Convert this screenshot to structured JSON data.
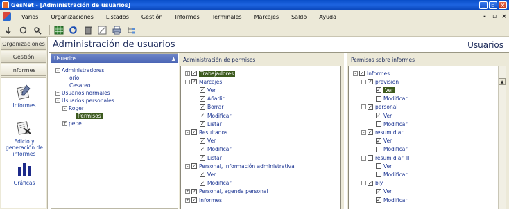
{
  "window": {
    "title": "GesNet - [Administración de usuarios]",
    "buttons": {
      "minimize": "_",
      "restore": "▫",
      "close": "×"
    }
  },
  "menu": {
    "items": [
      "Varios",
      "Organizaciones",
      "Listados",
      "Gestión",
      "Informes",
      "Terminales",
      "Marcajes",
      "Saldo",
      "Ayuda"
    ],
    "mdi": {
      "minimize": "-",
      "restore": "▫",
      "close": "×"
    }
  },
  "toolbar": {
    "buttons": [
      "left-arrow-icon",
      "refresh-icon",
      "filter-icon",
      "table-icon",
      "reload-icon",
      "trash-icon",
      "edit-icon",
      "print-icon",
      "tree-icon"
    ]
  },
  "nav": {
    "tabs": [
      "Organizaciones",
      "Gestión",
      "Informes"
    ],
    "entries": [
      {
        "label": "Informes",
        "icon": "report-icon"
      },
      {
        "label": "Edicio y generación de informes",
        "icon": "report-edit-icon"
      },
      {
        "label": "Gráficas",
        "icon": "bar-chart-icon"
      }
    ]
  },
  "page": {
    "title": "Administración de usuarios",
    "section": "Usuarios"
  },
  "users_panel": {
    "header": "Usuarios",
    "tree": [
      {
        "label": "Administradores",
        "level": 0,
        "toggle": "-"
      },
      {
        "label": "oriol",
        "level": 1
      },
      {
        "label": "Cesareo",
        "level": 1
      },
      {
        "label": "Usuarios normales",
        "level": 0,
        "toggle": "+"
      },
      {
        "label": "Usuarios personales",
        "level": 0,
        "toggle": "-"
      },
      {
        "label": "Roger",
        "level": 1,
        "toggle": "-"
      },
      {
        "label": "Permisos",
        "level": 2,
        "selected": true
      },
      {
        "label": "pepe",
        "level": 1,
        "toggle": "+"
      }
    ]
  },
  "perm_panel": {
    "header": "Administración de permisos",
    "tree": [
      {
        "label": "Trabajadores",
        "level": 0,
        "toggle": "+",
        "checked": true,
        "selected": true
      },
      {
        "label": "Marcajes",
        "level": 0,
        "toggle": "-",
        "checked": true
      },
      {
        "label": "Ver",
        "level": 1,
        "checked": true
      },
      {
        "label": "Añadir",
        "level": 1,
        "checked": true
      },
      {
        "label": "Borrar",
        "level": 1,
        "checked": true
      },
      {
        "label": "Modificar",
        "level": 1,
        "checked": true
      },
      {
        "label": "Listar",
        "level": 1,
        "checked": true
      },
      {
        "label": "Resultados",
        "level": 0,
        "toggle": "-",
        "checked": true
      },
      {
        "label": "Ver",
        "level": 1,
        "checked": true
      },
      {
        "label": "Modificar",
        "level": 1,
        "checked": true
      },
      {
        "label": "Listar",
        "level": 1,
        "checked": true
      },
      {
        "label": "Personal, información administrativa",
        "level": 0,
        "toggle": "-",
        "checked": true
      },
      {
        "label": "Ver",
        "level": 1,
        "checked": true
      },
      {
        "label": "Modificar",
        "level": 1,
        "checked": true
      },
      {
        "label": "Personal, agenda personal",
        "level": 0,
        "toggle": "+",
        "checked": true
      },
      {
        "label": "Informes",
        "level": 0,
        "toggle": "+",
        "checked": true
      }
    ]
  },
  "report_panel": {
    "header": "Permisos sobre informes",
    "tree": [
      {
        "label": "Informes",
        "level": 0,
        "toggle": "-",
        "checked": true
      },
      {
        "label": "prevision",
        "level": 1,
        "toggle": "-",
        "checked": true
      },
      {
        "label": "Ver",
        "level": 2,
        "checked": true,
        "selected": true
      },
      {
        "label": "Modificar",
        "level": 2,
        "checked": false
      },
      {
        "label": "personal",
        "level": 1,
        "toggle": "-",
        "checked": true
      },
      {
        "label": "Ver",
        "level": 2,
        "checked": true
      },
      {
        "label": "Modificar",
        "level": 2,
        "checked": false
      },
      {
        "label": "resum diari",
        "level": 1,
        "toggle": "-",
        "checked": true
      },
      {
        "label": "Ver",
        "level": 2,
        "checked": true
      },
      {
        "label": "Modificar",
        "level": 2,
        "checked": false
      },
      {
        "label": "resum diari II",
        "level": 1,
        "toggle": "-",
        "checked": false
      },
      {
        "label": "Ver",
        "level": 2,
        "checked": false
      },
      {
        "label": "Modificar",
        "level": 2,
        "checked": false
      },
      {
        "label": "bly",
        "level": 1,
        "toggle": "-",
        "checked": true
      },
      {
        "label": "Ver",
        "level": 2,
        "checked": true
      },
      {
        "label": "Modificar",
        "level": 2,
        "checked": true
      }
    ]
  }
}
